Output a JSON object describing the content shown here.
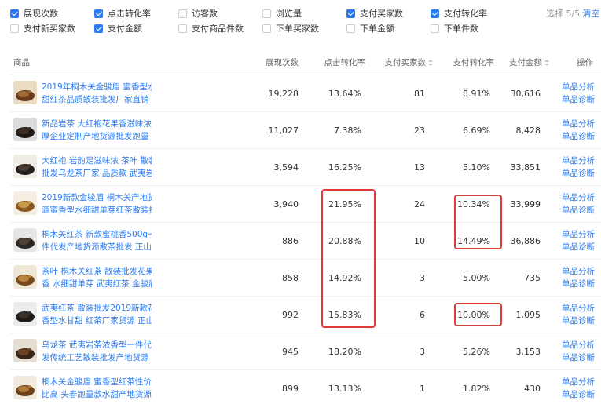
{
  "filters": [
    {
      "label": "展现次数",
      "checked": true
    },
    {
      "label": "点击转化率",
      "checked": true
    },
    {
      "label": "访客数",
      "checked": false
    },
    {
      "label": "浏览量",
      "checked": false
    },
    {
      "label": "支付买家数",
      "checked": true
    },
    {
      "label": "支付转化率",
      "checked": true
    },
    {
      "label": "支付新买家数",
      "checked": false
    },
    {
      "label": "支付金额",
      "checked": true
    },
    {
      "label": "支付商品件数",
      "checked": false
    },
    {
      "label": "下单买家数",
      "checked": false
    },
    {
      "label": "下单金额",
      "checked": false
    },
    {
      "label": "下单件数",
      "checked": false
    }
  ],
  "selection": {
    "text": "选择 5/5",
    "clear_label": "清空"
  },
  "columns": {
    "product": "商品",
    "impressions": "展现次数",
    "click_rate": "点击转化率",
    "pay_buyers": "支付买家数",
    "pay_rate": "支付转化率",
    "pay_amount": "支付金额",
    "actions": "操作"
  },
  "action_labels": {
    "analysis": "单品分析",
    "diagnosis": "单品诊断"
  },
  "rows": [
    {
      "name1": "2019年桐木关金骏眉 蜜香型水",
      "name2": "甜红茶品质散装批发厂家直销",
      "impressions": "19,228",
      "click_rate": "13.64%",
      "pay_buyers": "81",
      "pay_rate": "8.91%",
      "pay_amount": "30,616"
    },
    {
      "name1": "新品岩茶 大红袍花果香滋味浓",
      "name2": "厚企业定制产地货源批发跑量",
      "impressions": "11,027",
      "click_rate": "7.38%",
      "pay_buyers": "23",
      "pay_rate": "6.69%",
      "pay_amount": "8,428"
    },
    {
      "name1": "大红袍 岩韵足滋味浓 茶叶 散装",
      "name2": "批发乌龙茶厂家 品质款 武夷岩",
      "impressions": "3,594",
      "click_rate": "16.25%",
      "pay_buyers": "13",
      "pay_rate": "5.10%",
      "pay_amount": "33,851"
    },
    {
      "name1": "2019新款金骏眉 桐木关产地货",
      "name2": "源蜜香型水细甜单芽红茶散装批",
      "impressions": "3,940",
      "click_rate": "21.95%",
      "pay_buyers": "24",
      "pay_rate": "10.34%",
      "pay_amount": "33,999"
    },
    {
      "name1": "桐木关红茶 新款蜜桃香500g一",
      "name2": "件代发产地货源散茶批发 正山",
      "impressions": "886",
      "click_rate": "20.88%",
      "pay_buyers": "10",
      "pay_rate": "14.49%",
      "pay_amount": "36,886"
    },
    {
      "name1": "茶叶 桐木关红茶 散装批发花果",
      "name2": "香 水细甜单芽 武夷红茶 金骏眉",
      "impressions": "858",
      "click_rate": "14.92%",
      "pay_buyers": "3",
      "pay_rate": "5.00%",
      "pay_amount": "735"
    },
    {
      "name1": "武夷红茶 散装批发2019新款花",
      "name2": "香型水甘甜 红茶厂家货源 正山",
      "impressions": "992",
      "click_rate": "15.83%",
      "pay_buyers": "6",
      "pay_rate": "10.00%",
      "pay_amount": "1,095"
    },
    {
      "name1": "乌龙茶 武夷岩茶浓香型一件代",
      "name2": "发传统工艺散装批发产地货源",
      "impressions": "945",
      "click_rate": "18.20%",
      "pay_buyers": "3",
      "pay_rate": "5.26%",
      "pay_amount": "3,153"
    },
    {
      "name1": "桐木关金骏眉 蜜香型红茶性价",
      "name2": "比高 头春跑量款水甜产地货源",
      "impressions": "899",
      "click_rate": "13.13%",
      "pay_buyers": "1",
      "pay_rate": "1.82%",
      "pay_amount": "430"
    }
  ],
  "colors": {
    "accent": "#2b7cf2",
    "highlight": "#e13a3a"
  }
}
